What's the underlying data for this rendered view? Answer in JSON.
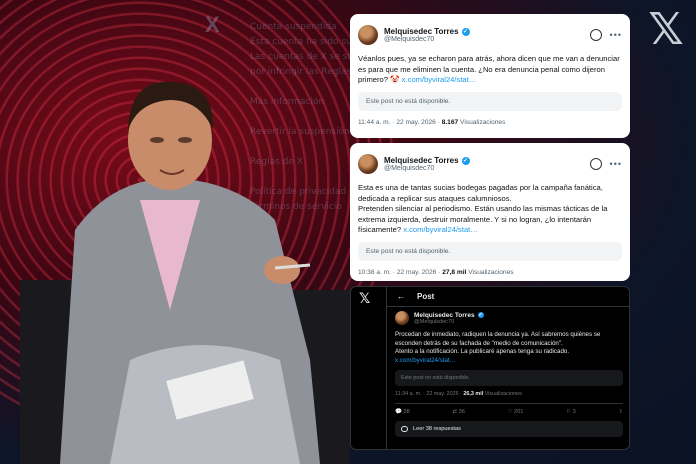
{
  "background": {
    "text_lines": [
      "Cuenta suspendida",
      "Esta cuenta ha sido suspendida",
      "Las cuentas de X se suspenden",
      "por infringir las Reglas de X.",
      "",
      "Más información",
      "",
      "Revertir la suspensión",
      "",
      "Reglas de X",
      "",
      "Política de privacidad",
      "Términos de servicio"
    ]
  },
  "tweet1": {
    "name": "Melquisedec Torres",
    "handle": "@Melquisdec70",
    "text": "Véanlos pues, ya se echaron para atrás, ahora dicen que me van a denunciar es para que me eliminen la cuenta. ¿No era denuncia penal como dijeron primero? 🤡",
    "link": "x.com/byviral24/stat…",
    "unavailable": "Este post no está disponible.",
    "time": "11:44 a. m. · 22 may. 2026 · ",
    "views": "8.167",
    "views_label": " Visualizaciones"
  },
  "tweet2": {
    "name": "Melquisedec Torres",
    "handle": "@Melquisdec70",
    "text": "Esta es una de tantas sucias bodegas pagadas por la campaña fanática, dedicada a replicar sus ataques calumniosos.\nPretenden silenciar al periodismo. Están usando las mismas tácticas de la extrema izquierda, destruir moralmente. Y si no logran, ¿lo intentarán físicamente?",
    "link": "x.com/byviral24/stat…",
    "unavailable": "Este post no está disponible.",
    "time": "10:38 a. m. · 22 may. 2026 · ",
    "views": "27,8 mil",
    "views_label": " Visualizaciones"
  },
  "tweet3": {
    "page_title": "Post",
    "name": "Melquisedec Torres",
    "handle": "@Melquisdec70",
    "text": "Procedan de inmediato, radiquen la denuncia ya. Así sabremos quiénes se esconden detrás de su fachada de \"medio de comunicación\".\nAtento a la notificación. La publicaré apenas tenga su radicado.",
    "link": "x.com/byviral24/stat…",
    "unavailable": "Este post no está disponible.",
    "time": "11:34 a. m. · 22 may. 2026 · ",
    "views": "26,3 mil",
    "views_label": " Visualizaciones",
    "replies": "38",
    "reposts": "36",
    "likes": "201",
    "bookmarks": "3",
    "read_replies": "Leer 38 respuestas"
  },
  "colors": {
    "accent": "#1d9bf0",
    "dark_bg": "#000000",
    "red_bg": "#7a0b1a"
  }
}
